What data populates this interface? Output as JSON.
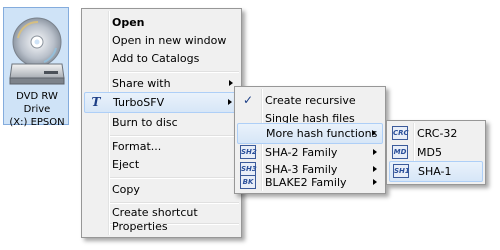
{
  "drive": {
    "label_line1": "DVD RW Drive",
    "label_line2": "(X:) EPSON"
  },
  "context_menu": {
    "items": [
      {
        "label": "Open",
        "bold": true
      },
      {
        "label": "Open in new window"
      },
      {
        "label": "Add to Catalogs"
      },
      {
        "label": "Share with",
        "submenu": true
      },
      {
        "label": "TurboSFV",
        "submenu": true,
        "icon": "turbosfv-icon",
        "icon_text": "T"
      },
      {
        "label": "Burn to disc"
      },
      {
        "label": "Format..."
      },
      {
        "label": "Eject"
      },
      {
        "label": "Copy"
      },
      {
        "label": "Create shortcut"
      },
      {
        "label": "Properties"
      }
    ]
  },
  "turbosfv_menu": {
    "items": [
      {
        "label": "Create recursive",
        "icon": "checkmark-icon",
        "icon_text": "✓"
      },
      {
        "label": "Single hash files"
      },
      {
        "label": "More hash functions",
        "submenu": true
      },
      {
        "label": "SHA-2 Family",
        "submenu": true,
        "icon": "sha2-icon",
        "icon_text": "SH2"
      },
      {
        "label": "SHA-3 Family",
        "submenu": true,
        "icon": "sha3-icon",
        "icon_text": "SH3"
      },
      {
        "label": "BLAKE2 Family",
        "submenu": true,
        "icon": "blake2-icon",
        "icon_text": "BK"
      }
    ]
  },
  "hash_menu": {
    "items": [
      {
        "label": "CRC-32",
        "icon": "crc-icon",
        "icon_text": "CRC"
      },
      {
        "label": "MD5",
        "icon": "md5-icon",
        "icon_text": "MD"
      },
      {
        "label": "SHA-1",
        "icon": "sha1-icon",
        "icon_text": "SH1"
      }
    ]
  },
  "colors": {
    "highlight_border": "#aecff7",
    "highlight_fill": "#d7e6f7",
    "menu_bg": "#f0f0f0",
    "icon_blue": "#1c3e86"
  }
}
